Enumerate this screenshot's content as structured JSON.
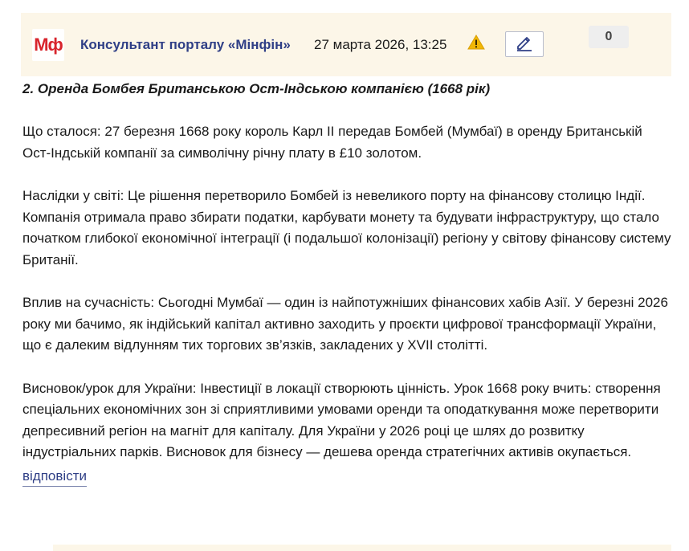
{
  "comment": {
    "logo_text": "Мф",
    "author": "Консультант порталу «Мінфін»",
    "date": "27 марта 2026, 13:25",
    "votes": "0",
    "subtitle": "2. Оренда Бомбея Британською Ост-Індською компанією (1668 рік)",
    "paragraphs": [
      "Що сталося: 27 березня 1668 року король Карл II передав Бомбей (Мумбаї) в оренду Британській Ост-Індській компанії за символічну річну плату в £10 золотом.",
      "Наслідки у світі: Це рішення перетворило Бомбей із невеликого порту на фінансову столицю Індії. Компанія отримала право збирати податки, карбувати монету та будувати інфраструктуру, що стало початком глибокої економічної інтеграції (і подальшої колонізації) регіону у світову фінансову систему Британії.",
      "Вплив на сучасність: Сьогодні Мумбаї — один із найпотужніших фінансових хабів Азії. У березні 2026 року ми бачимо, як індійський капітал активно заходить у проєкти цифрової трансформації України, що є далеким відлунням тих торгових зв’язків, закладених у XVII столітті.",
      "Висновок/урок для України: Інвестиції в локації створюють цінність. Урок 1668 року вчить: створення спеціальних економічних зон зі сприятливими умовами оренди та оподаткування може перетворити депресивний регіон на магніт для капіталу. Для України у 2026 році це шлях до розвитку індустріальних парків. Висновок для бізнесу — дешева оренда стратегічних активів окупається."
    ],
    "reply_label": "відповісти"
  },
  "icons": {
    "warning": "warning-triangle-icon",
    "edit": "pencil-icon"
  },
  "colors": {
    "header_bg": "#fcf6e8",
    "author": "#2f3f86",
    "logo_red": "#d8242c",
    "warning_yellow": "#f2b705"
  }
}
